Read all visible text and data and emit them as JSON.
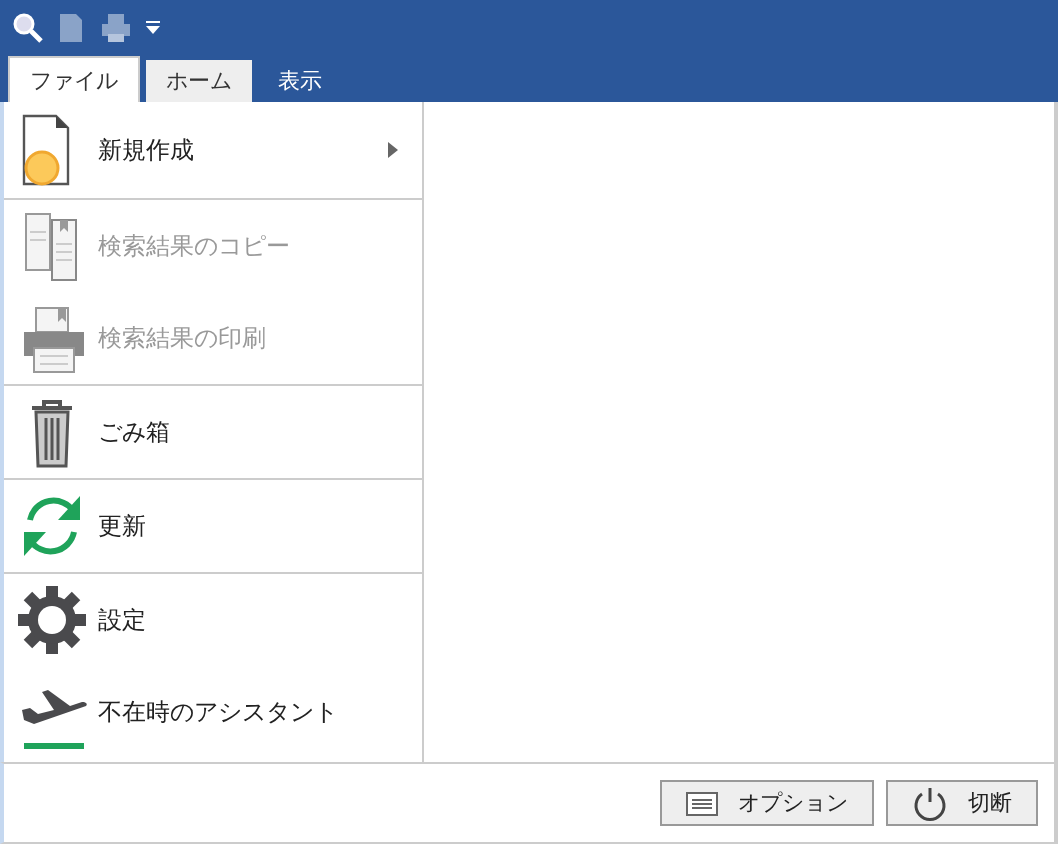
{
  "tabs": [
    {
      "label": "ファイル",
      "selected": true
    },
    {
      "label": "ホーム",
      "selected": false,
      "hover": true
    },
    {
      "label": "表示",
      "selected": false,
      "hover": false
    }
  ],
  "menu": [
    {
      "label": "新規作成",
      "kind": "new",
      "disabled": false,
      "submenu": true,
      "divider_after": true
    },
    {
      "label": "検索結果のコピー",
      "kind": "copy",
      "disabled": true,
      "submenu": false,
      "divider_after": false
    },
    {
      "label": "検索結果の印刷",
      "kind": "print",
      "disabled": true,
      "submenu": false,
      "divider_after": true
    },
    {
      "label": "ごみ箱",
      "kind": "trash",
      "disabled": false,
      "submenu": false,
      "divider_after": true
    },
    {
      "label": "更新",
      "kind": "refresh",
      "disabled": false,
      "submenu": false,
      "divider_after": true
    },
    {
      "label": "設定",
      "kind": "gear",
      "disabled": false,
      "submenu": false,
      "divider_after": false
    },
    {
      "label": "不在時のアシスタント",
      "kind": "plane",
      "disabled": false,
      "submenu": false,
      "divider_after": false
    }
  ],
  "buttons": [
    {
      "label": "オプション",
      "kind": "options"
    },
    {
      "label": "切断",
      "kind": "power"
    }
  ]
}
